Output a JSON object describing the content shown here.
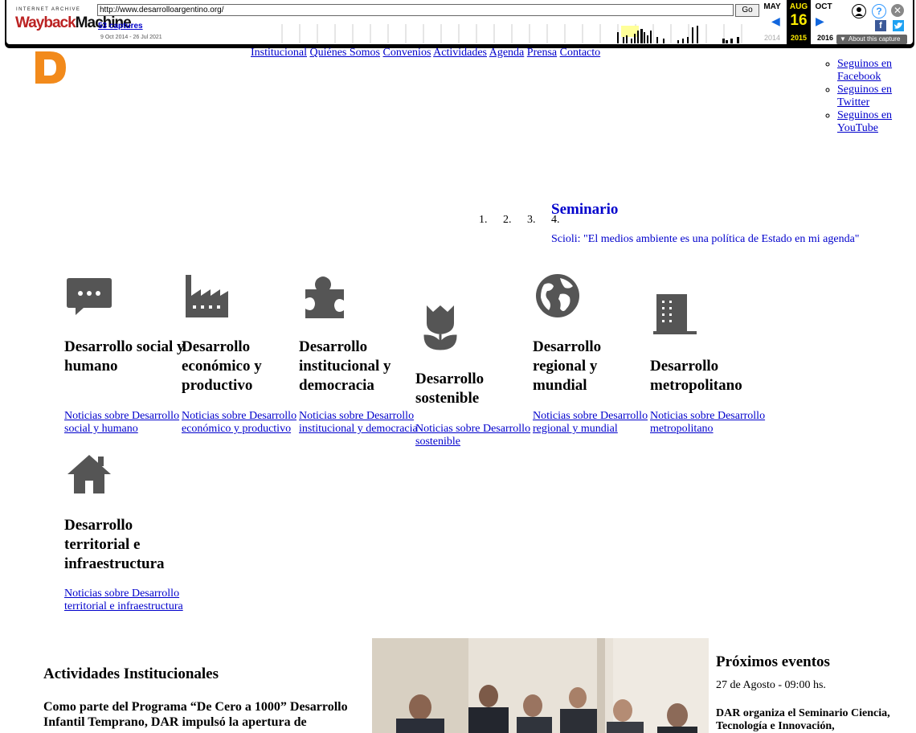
{
  "wayback": {
    "logo_top": "INTERNET ARCHIVE",
    "logo_wayback": "Wayback",
    "logo_machine": "Machine",
    "url": "http://www.desarrolloargentino.org/",
    "go_label": "Go",
    "captures": "53 captures",
    "range": "9 Oct 2014 - 26 Jul 2021",
    "prev_month": "MAY",
    "cur_month": "AUG",
    "next_month": "OCT",
    "cur_day": "16",
    "prev_year": "2014",
    "cur_year": "2015",
    "next_year": "2016",
    "about": "About this capture"
  },
  "site": {
    "nav": [
      "Institucional",
      "Quiénes Somos",
      "Convenios",
      "Actividades",
      "Agenda",
      "Prensa",
      "Contacto"
    ],
    "social": [
      {
        "label": "Seguinos en Facebook"
      },
      {
        "label": "Seguinos en Twitter"
      },
      {
        "label": "Seguinos en YouTube"
      }
    ],
    "slider": {
      "nums": [
        "1.",
        "2.",
        "3.",
        "4."
      ],
      "title": "Seminario",
      "subtitle": "Scioli: \"El medios ambiente es una política de Estado en mi agenda\""
    },
    "categories": [
      {
        "icon": "chat-icon",
        "title": "Desarrollo social y humano",
        "link": "Noticias sobre Desarrollo social y humano"
      },
      {
        "icon": "factory-icon",
        "title": "Desarrollo económico y productivo",
        "link": "Noticias sobre Desarrollo económico y productivo"
      },
      {
        "icon": "puzzle-icon",
        "title": "Desarrollo institucional y democracia",
        "link": "Noticias sobre Desarrollo institucional y democracia"
      },
      {
        "icon": "flower-icon",
        "title": "Desarrollo sostenible",
        "link": "Noticias sobre Desarrollo sostenible"
      },
      {
        "icon": "globe-icon",
        "title": "Desarrollo regional y mundial",
        "link": "Noticias sobre Desarrollo regional y mundial"
      },
      {
        "icon": "building-icon",
        "title": "Desarrollo metropolitano",
        "link": "Noticias sobre Desarrollo metropolitano"
      },
      {
        "icon": "home-icon",
        "title": "Desarrollo territorial e infraestructura",
        "link": "Noticias sobre Desarrollo territorial e infraestructura"
      }
    ],
    "activities": {
      "title": "Actividades Institucionales",
      "text": "Como parte del Programa “De Cero a 1000” Desarrollo Infantil Temprano, DAR impulsó la apertura de"
    },
    "events": {
      "title": "Próximos eventos",
      "date": "27 de Agosto - 09:00 hs.",
      "text": "DAR organiza el Seminario Ciencia, Tecnología e Innovación,"
    }
  }
}
